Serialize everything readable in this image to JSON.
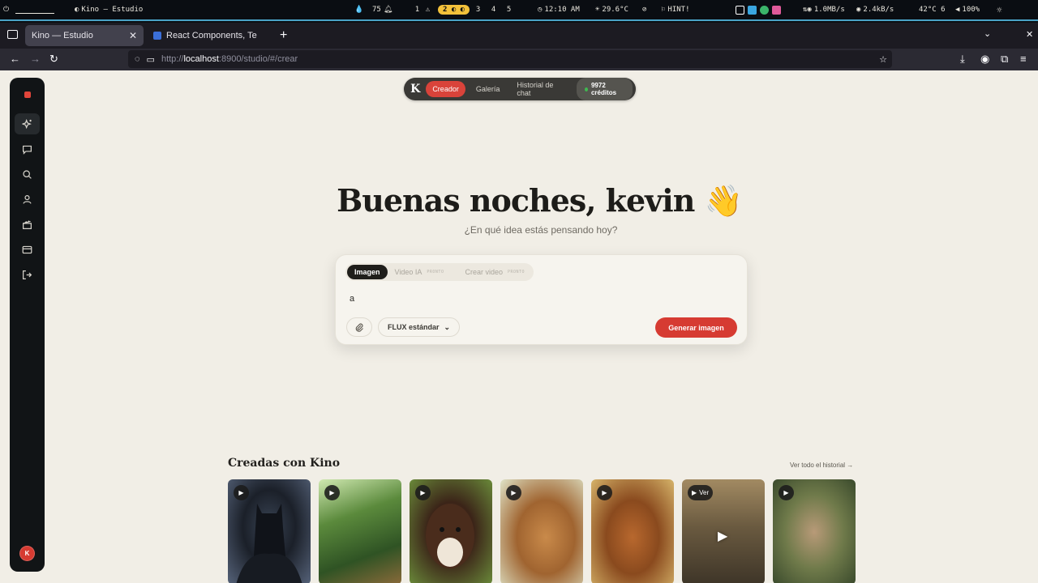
{
  "sysbar": {
    "left_label": "Kino — Estudio",
    "counter": "75",
    "workspaces": [
      "1",
      "2",
      "3",
      "4",
      "5"
    ],
    "active_workspace": "2",
    "clock": "12:10 AM",
    "weather": "29.6°C",
    "hint": "HINT!",
    "down": "1.0MB/s",
    "up": "2.4kB/s",
    "cpu_temp": "42°C 6",
    "volume": "100%"
  },
  "browser": {
    "tabs": [
      {
        "title": "Kino — Estudio",
        "active": true
      },
      {
        "title": "React Components, Temp",
        "active": false
      }
    ],
    "url_prefix": "http://",
    "url_host": "localhost",
    "url_rest": ":8900/studio/#/crear"
  },
  "sidebar": {
    "icons": [
      "sparkle-icon",
      "chat-icon",
      "search-icon",
      "user-icon",
      "clapper-icon",
      "card-icon",
      "logout-icon"
    ],
    "avatar_initial": "K"
  },
  "topnav": {
    "logo": "K",
    "items": [
      "Creador",
      "Galería",
      "Historial de chat"
    ],
    "active": "Creador",
    "credits": "9972 créditos"
  },
  "hero": {
    "greeting": "Buenas noches, kevin 👋",
    "subtitle": "¿En qué idea estás pensando hoy?"
  },
  "composer": {
    "modes": [
      {
        "label": "Imagen",
        "badge": ""
      },
      {
        "label": "Video IA",
        "badge": "PRONTO"
      },
      {
        "label": "Crear video",
        "badge": "PRONTO"
      }
    ],
    "prompt_value": "a",
    "model": "FLUX estándar",
    "generate_label": "Generar imagen"
  },
  "gallery": {
    "title": "Creadas con Kino",
    "link": "Ver todo el historial →",
    "hover_label": "Ver",
    "items": [
      {
        "name": "batman"
      },
      {
        "name": "forest"
      },
      {
        "name": "puppy"
      },
      {
        "name": "golden-dog"
      },
      {
        "name": "brown-dog"
      },
      {
        "name": "boy"
      },
      {
        "name": "runner"
      }
    ]
  },
  "colors": {
    "accent": "#d63b32",
    "page_bg": "#f1eee6",
    "sidebar_bg": "#111416"
  }
}
